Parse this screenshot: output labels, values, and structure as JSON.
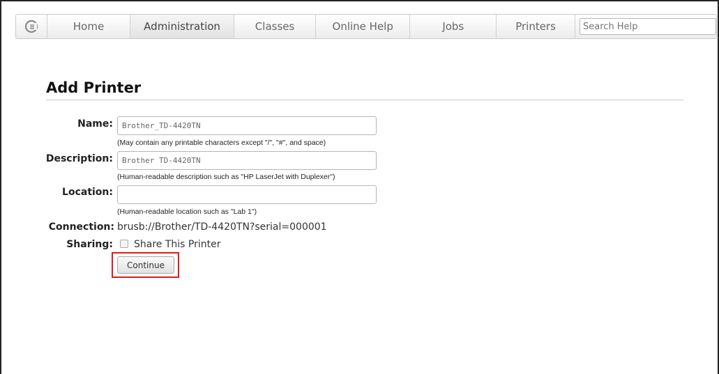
{
  "nav": {
    "logo_icon": "cups-logo-icon",
    "tabs": [
      {
        "label": "Home",
        "active": false
      },
      {
        "label": "Administration",
        "active": true
      },
      {
        "label": "Classes",
        "active": false
      },
      {
        "label": "Online Help",
        "active": false
      },
      {
        "label": "Jobs",
        "active": false
      },
      {
        "label": "Printers",
        "active": false
      }
    ],
    "search_placeholder": "Search Help"
  },
  "page": {
    "title": "Add Printer"
  },
  "form": {
    "name": {
      "label": "Name:",
      "value": "Brother_TD-4420TN",
      "hint": "(May contain any printable characters except \"/\", \"#\", and space)"
    },
    "description": {
      "label": "Description:",
      "value": "Brother TD-4420TN",
      "hint": "(Human-readable description such as \"HP LaserJet with Duplexer\")"
    },
    "location": {
      "label": "Location:",
      "value": "",
      "hint": "(Human-readable location such as \"Lab 1\")"
    },
    "connection": {
      "label": "Connection:",
      "value": "brusb://Brother/TD-4420TN?serial=000001"
    },
    "sharing": {
      "label": "Sharing:",
      "checkbox_label": "Share This Printer",
      "checked": false
    },
    "continue_label": "Continue"
  },
  "colors": {
    "highlight": "#e01a1a"
  }
}
